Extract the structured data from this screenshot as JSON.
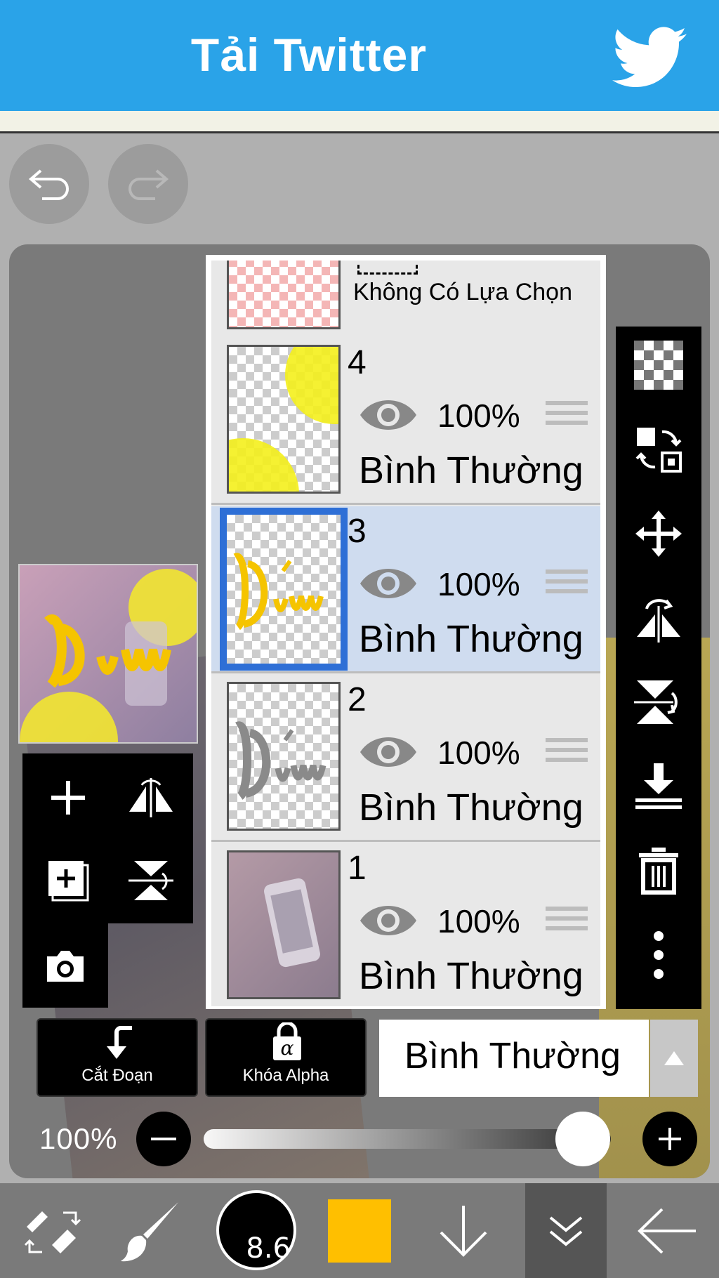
{
  "banner": {
    "title": "Tải Twitter"
  },
  "layers_panel": {
    "selection_layer": {
      "label": "Không Có Lựa Chọn"
    },
    "layers": [
      {
        "number": "4",
        "opacity": "100%",
        "blend": "Bình Thường",
        "selected": false
      },
      {
        "number": "3",
        "opacity": "100%",
        "blend": "Bình Thường",
        "selected": true
      },
      {
        "number": "2",
        "opacity": "100%",
        "blend": "Bình Thường",
        "selected": false
      },
      {
        "number": "1",
        "opacity": "100%",
        "blend": "Bình Thường",
        "selected": false
      }
    ]
  },
  "controls": {
    "clipping_label": "Cắt Đoạn",
    "alpha_lock_label": "Khóa Alpha",
    "blend_mode": "Bình Thường",
    "opacity_label": "100%",
    "opacity_value": 1.0
  },
  "toolbar": {
    "brush_size": "8.6",
    "current_color": "#ffbf00"
  },
  "colors": {
    "accent": "#2e6fd6",
    "banner": "#2aa3e8",
    "selected_row": "#cfdcef"
  }
}
